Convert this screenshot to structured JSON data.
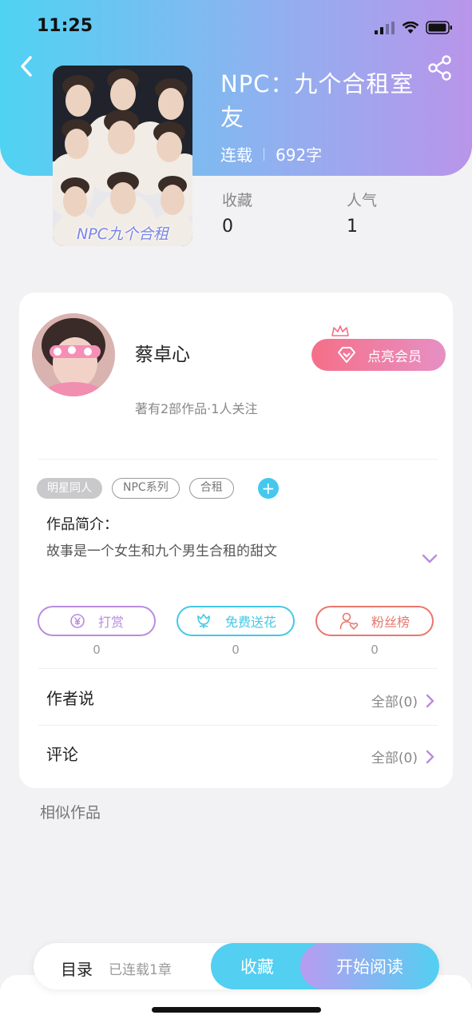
{
  "status_bar": {
    "time": "11:25"
  },
  "book": {
    "title": "NPC：九个合租室友",
    "status": "连载",
    "word_count": "692字",
    "cover_caption": "NPC九个合租",
    "stats": [
      {
        "label": "收藏",
        "value": "0"
      },
      {
        "label": "人气",
        "value": "1"
      }
    ]
  },
  "author": {
    "name": "蔡卓心",
    "meta": "著有2部作品·1人关注",
    "vip_button": "点亮会员"
  },
  "tags": [
    "明星同人",
    "NPC系列",
    "合租"
  ],
  "intro": {
    "label": "作品简介：",
    "text": "故事是一个女生和九个男生合租的甜文"
  },
  "actions": [
    {
      "label": "打赏",
      "count": "0",
      "icon": "yen-coin-icon",
      "color": "#b98ce0"
    },
    {
      "label": "免费送花",
      "count": "0",
      "icon": "flower-icon",
      "color": "#45c8e6"
    },
    {
      "label": "粉丝榜",
      "count": "0",
      "icon": "fan-user-icon",
      "color": "#e8776f"
    }
  ],
  "sections": [
    {
      "label": "作者说",
      "right": "全部(0)"
    },
    {
      "label": "评论",
      "right": "全部(0)"
    }
  ],
  "similar_label": "相似作品",
  "bottom_bar": {
    "toc_label": "目录",
    "toc_info": "已连载1章",
    "favorite_label": "收藏",
    "read_label": "开始阅读"
  },
  "colors": {
    "accent_cyan": "#52cff1",
    "accent_purple": "#b995ea",
    "vip_pink": "#f56f88"
  }
}
